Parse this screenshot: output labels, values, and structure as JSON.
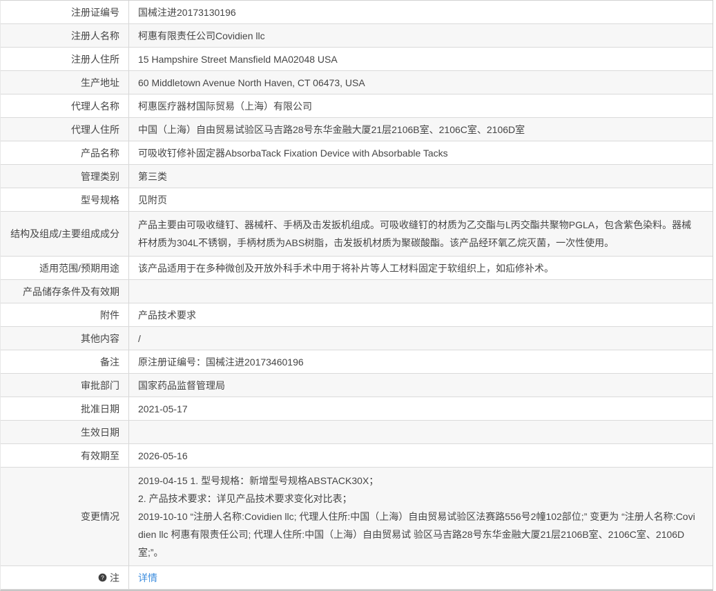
{
  "colors": {
    "link": "#3e8ede",
    "stripe": "#f7f7f7",
    "border": "#d2d2d2",
    "text": "#454545"
  },
  "table": {
    "rows": [
      {
        "label": "注册证编号",
        "value": "国械注进20173130196"
      },
      {
        "label": "注册人名称",
        "value": "柯惠有限责任公司Covidien llc"
      },
      {
        "label": "注册人住所",
        "value": "15 Hampshire Street Mansfield MA02048 USA"
      },
      {
        "label": "生产地址",
        "value": "60 Middletown Avenue North Haven, CT 06473, USA"
      },
      {
        "label": "代理人名称",
        "value": "柯惠医疗器材国际贸易（上海）有限公司"
      },
      {
        "label": "代理人住所",
        "value": "中国（上海）自由贸易试验区马吉路28号东华金融大厦21层2106B室、2106C室、2106D室"
      },
      {
        "label": "产品名称",
        "value": "可吸收钉修补固定器AbsorbaTack Fixation Device with Absorbable Tacks"
      },
      {
        "label": "管理类别",
        "value": "第三类"
      },
      {
        "label": "型号规格",
        "value": "见附页"
      },
      {
        "label": "结构及组成/主要组成成分",
        "lines": [
          "产品主要由可吸收缝钉、器械杆、手柄及击发扳机组成。可吸收缝钉的材质为乙交酯与L丙交酯共聚物PGLA，包含紫色染料。器械杆材质为304L不锈钢，手柄材质为ABS树脂，击发扳机材质为聚碳酸酯。该产品经环氧乙烷灭菌，一次性使用。"
        ]
      },
      {
        "label": "适用范围/预期用途",
        "value": "该产品适用于在多种微创及开放外科手术中用于将补片等人工材料固定于软组织上，如疝修补术。"
      },
      {
        "label": "产品储存条件及有效期",
        "value": ""
      },
      {
        "label": "附件",
        "value": "产品技术要求"
      },
      {
        "label": "其他内容",
        "value": "/"
      },
      {
        "label": "备注",
        "value": "原注册证编号：国械注进20173460196"
      },
      {
        "label": "审批部门",
        "value": "国家药品监督管理局"
      },
      {
        "label": "批准日期",
        "value": "2021-05-17"
      },
      {
        "label": "生效日期",
        "value": ""
      },
      {
        "label": "有效期至",
        "value": "2026-05-16"
      },
      {
        "label": "变更情况",
        "lines": [
          "2019-04-15 1. 型号规格：新增型号规格ABSTACK30X；",
          "2. 产品技术要求：详见产品技术要求变化对比表；",
          "2019-10-10 “注册人名称:Covidien llc; 代理人住所:中国（上海）自由贸易试验区法赛路556号2幢102部位;” 变更为 “注册人名称:Covidien llc 柯惠有限责任公司; 代理人住所:中国（上海）自由贸易试 验区马吉路28号东华金融大厦21层2106B室、2106C室、2106D室;”。"
        ]
      },
      {
        "label": "注",
        "icon": "note-icon",
        "link": "详情"
      }
    ]
  }
}
